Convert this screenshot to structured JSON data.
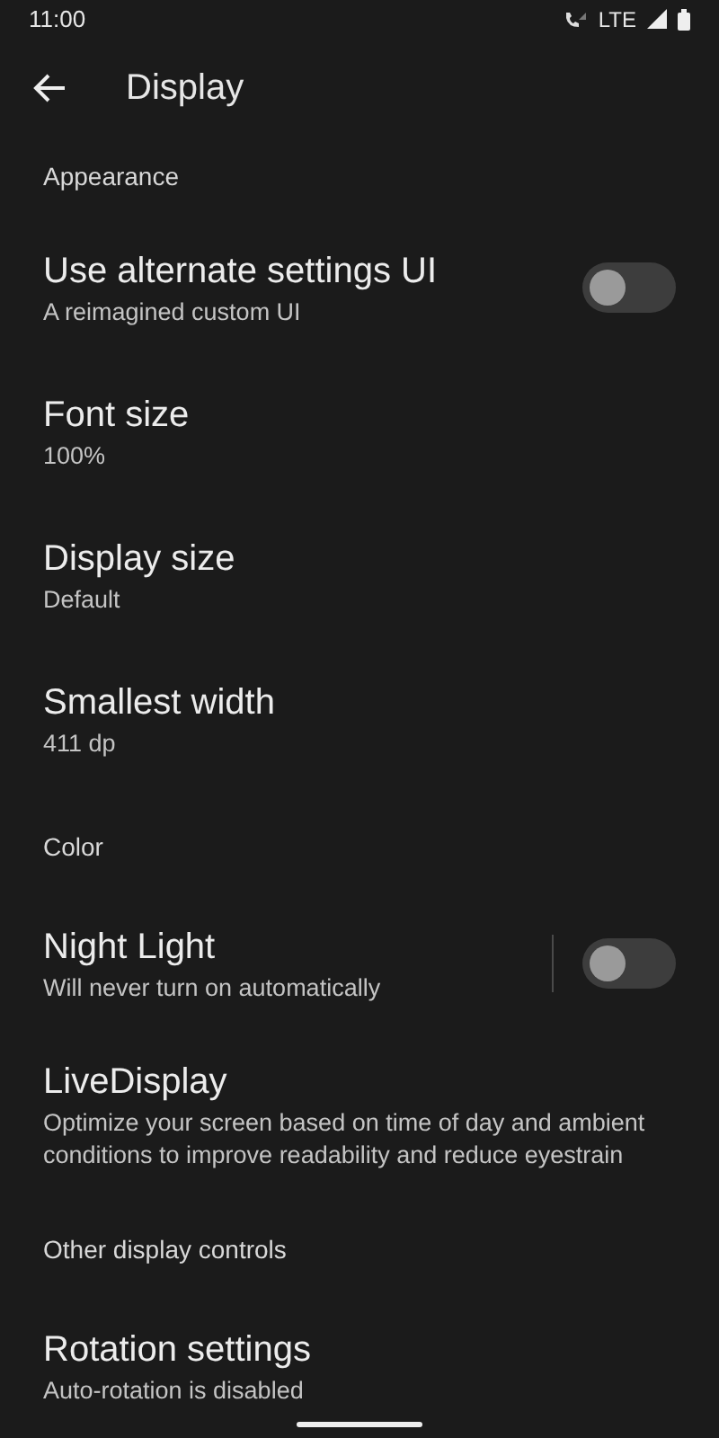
{
  "status_bar": {
    "time": "11:00",
    "network": "LTE"
  },
  "toolbar": {
    "title": "Display"
  },
  "sections": [
    {
      "header": "Appearance",
      "items": [
        {
          "kind": "switch",
          "title": "Use alternate settings UI",
          "summary": "A reimagined custom UI",
          "on": false,
          "divider": false
        },
        {
          "kind": "plain",
          "title": "Font size",
          "summary": "100%"
        },
        {
          "kind": "plain",
          "title": "Display size",
          "summary": "Default"
        },
        {
          "kind": "plain",
          "title": "Smallest width",
          "summary": "411 dp"
        }
      ]
    },
    {
      "header": "Color",
      "items": [
        {
          "kind": "switch",
          "title": "Night Light",
          "summary": "Will never turn on automatically",
          "on": false,
          "divider": true
        },
        {
          "kind": "plain",
          "title": "LiveDisplay",
          "summary": "Optimize your screen based on time of day and ambient conditions to improve readability and reduce eyestrain"
        }
      ]
    },
    {
      "header": "Other display controls",
      "items": [
        {
          "kind": "plain",
          "title": "Rotation settings",
          "summary": "Auto-rotation is disabled"
        }
      ]
    }
  ]
}
